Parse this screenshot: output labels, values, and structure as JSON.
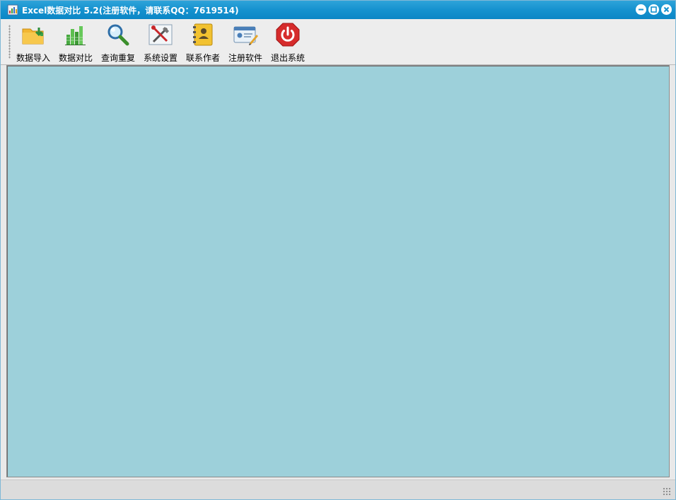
{
  "window": {
    "title": "Excel数据对比  5.2(注册软件，请联系QQ：7619514)"
  },
  "toolbar": {
    "items": [
      {
        "label": "数据导入",
        "icon": "folder-import-icon"
      },
      {
        "label": "数据对比",
        "icon": "bar-chart-icon"
      },
      {
        "label": "查询重复",
        "icon": "magnifier-icon"
      },
      {
        "label": "系统设置",
        "icon": "tools-settings-icon"
      },
      {
        "label": "联系作者",
        "icon": "contact-book-icon"
      },
      {
        "label": "注册软件",
        "icon": "register-card-icon"
      },
      {
        "label": "退出系统",
        "icon": "power-exit-icon"
      }
    ]
  },
  "colors": {
    "titlebar": "#1592cf",
    "content_background": "#9dd0da",
    "toolbar_background": "#ededed"
  }
}
